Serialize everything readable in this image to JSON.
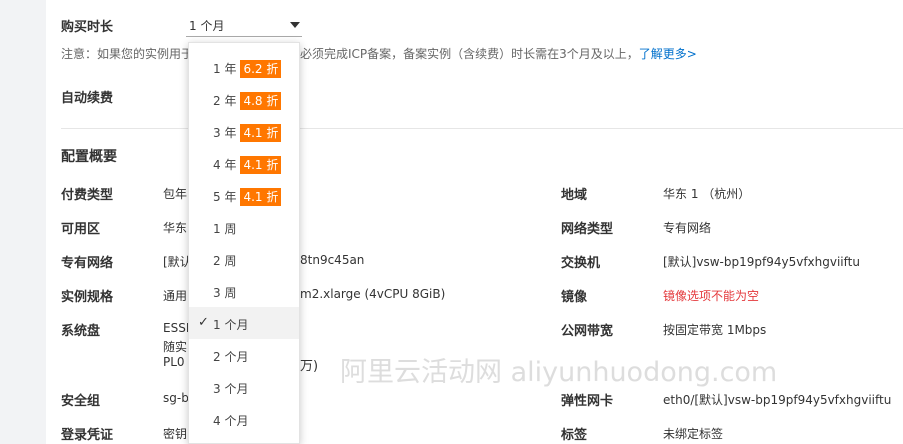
{
  "purchase": {
    "duration_label": "购买时长",
    "selected_value": "1 个月",
    "notice_prefix": "注意：如果您的实例用于",
    "notice_suffix": "必须完成ICP备案，备案实例（含续费）时长需在3个月及以上，",
    "learn_more": "了解更多>",
    "auto_renew_label": "自动续费"
  },
  "dropdown": {
    "options": [
      {
        "label": "1 年",
        "badge": "6.2 折"
      },
      {
        "label": "2 年",
        "badge": "4.8 折"
      },
      {
        "label": "3 年",
        "badge": "4.1 折"
      },
      {
        "label": "4 年",
        "badge": "4.1 折"
      },
      {
        "label": "5 年",
        "badge": "4.1 折"
      },
      {
        "label": "1 周"
      },
      {
        "label": "2 周"
      },
      {
        "label": "3 周"
      },
      {
        "label": "1 个月",
        "selected": true,
        "check": "✓"
      },
      {
        "label": "2 个月"
      },
      {
        "label": "3 个月"
      },
      {
        "label": "4 个月"
      }
    ]
  },
  "summary": {
    "title": "配置概要",
    "left": [
      {
        "label": "付费类型",
        "value": "包年"
      },
      {
        "label": "可用区",
        "value": "华东"
      },
      {
        "label": "专有网络",
        "value": "[默认",
        "value_tail": "8tn9c45an"
      },
      {
        "label": "实例规格",
        "value": "通用",
        "value_tail": "m2.xlarge (4vCPU 8GiB)"
      },
      {
        "label": "系统盘",
        "value": "ESSD",
        "value2": "随实",
        "value3": "PL0",
        "value3_tail": "万)"
      },
      {
        "label": "安全组",
        "value": "sg-b"
      },
      {
        "label": "登录凭证",
        "value": "密钥"
      }
    ],
    "right": [
      {
        "label": "地域",
        "value": "华东 1 （杭州）"
      },
      {
        "label": "网络类型",
        "value": "专有网络"
      },
      {
        "label": "交换机",
        "value": "[默认]vsw-bp19pf94y5vfxhgviiftu"
      },
      {
        "label": "镜像",
        "value": "镜像选项不能为空"
      },
      {
        "label": "公网带宽",
        "value": "按固定带宽 1Mbps"
      },
      {
        "label": "弹性网卡",
        "value": "eth0/[默认]vsw-bp19pf94y5vfxhgviiftu"
      },
      {
        "label": "标签",
        "value": "未绑定标签"
      }
    ]
  },
  "watermark": "阿里云活动网 aliyunhuodong.com",
  "colors": {
    "badge": "#ff7700",
    "link": "#0070cc",
    "error": "#e4393c"
  }
}
